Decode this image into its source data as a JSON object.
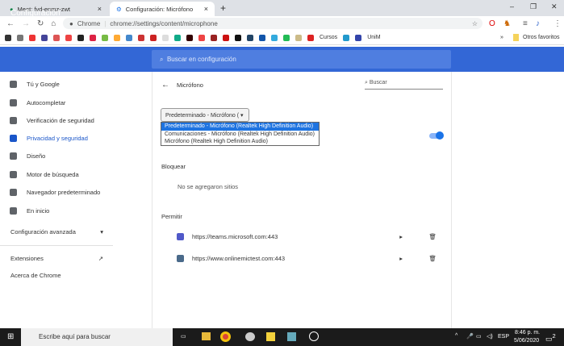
{
  "tabs": [
    {
      "title": "Meet: fvd-enmz-zwt",
      "active": false
    },
    {
      "title": "Configuración: Micrófono",
      "active": true
    }
  ],
  "toolbar": {
    "site_label": "Chrome",
    "url": "chrome://settings/content/microphone"
  },
  "bookmarks": {
    "items": [
      "Cursos",
      "UniM"
    ],
    "other": "Otros favoritos"
  },
  "header": {
    "title": "Configuración",
    "search_placeholder": "Buscar en configuración"
  },
  "sidebar": {
    "items": [
      "Tú y Google",
      "Autocompletar",
      "Verificación de seguridad",
      "Privacidad y seguridad",
      "Diseño",
      "Motor de búsqueda",
      "Navegador predeterminado",
      "En inicio"
    ],
    "selected": 3,
    "advanced": "Configuración avanzada",
    "extensions": "Extensiones",
    "about": "Acerca de Chrome"
  },
  "page": {
    "title": "Micrófono",
    "search_placeholder": "Buscar",
    "select_value": "Predeterminado - Micrófono (",
    "options": [
      "Predeterminado - Micrófono (Realtek High Definition Audio)",
      "Comunicaciones - Micrófono (Realtek High Definition Audio)",
      "Micrófono (Realtek High Definition Audio)"
    ],
    "toggle_on": true,
    "block_heading": "Bloquear",
    "block_empty": "No se agregaron sitios",
    "allow_heading": "Permitir",
    "allowed": [
      "https://teams.microsoft.com:443",
      "https://www.onlinemictest.com:443"
    ]
  },
  "taskbar": {
    "search": "Escribe aquí para buscar",
    "lang": "ESP",
    "time": "8:46 p. m.",
    "date": "5/06/2020",
    "notifications": "2"
  }
}
